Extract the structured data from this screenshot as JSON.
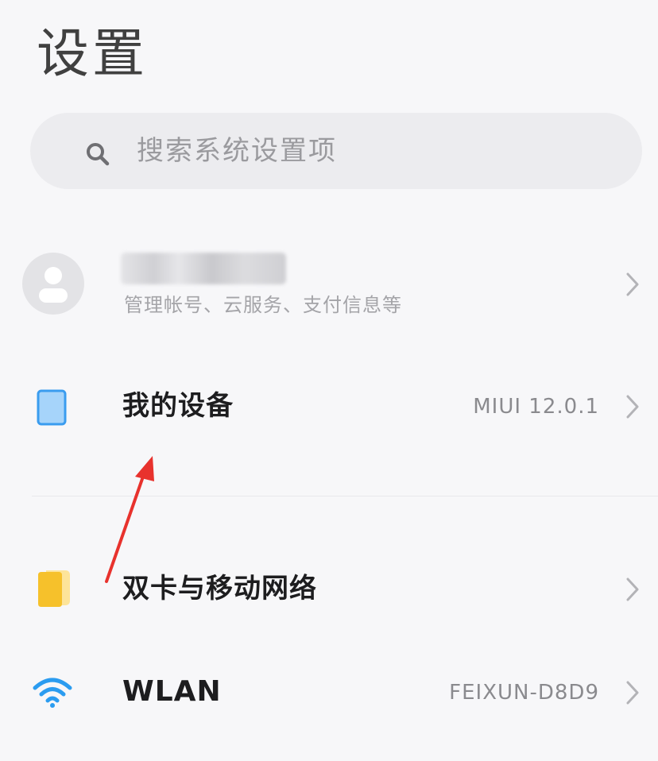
{
  "header": {
    "title": "设置"
  },
  "search": {
    "placeholder": "搜索系统设置项"
  },
  "account": {
    "subtitle": "管理帐号、云服务、支付信息等",
    "icon": "user-avatar-icon"
  },
  "items": [
    {
      "label": "我的设备",
      "value": "MIUI 12.0.1",
      "icon": "device-icon",
      "color": "#4aa6f0"
    },
    {
      "label": "双卡与移动网络",
      "value": "",
      "icon": "sim-card-icon",
      "color": "#f7c531"
    },
    {
      "label": "WLAN",
      "value": "FEIXUN-D8D9",
      "icon": "wifi-icon",
      "color": "#2b9cf0"
    }
  ],
  "annotation": {
    "color": "#e8322d"
  }
}
